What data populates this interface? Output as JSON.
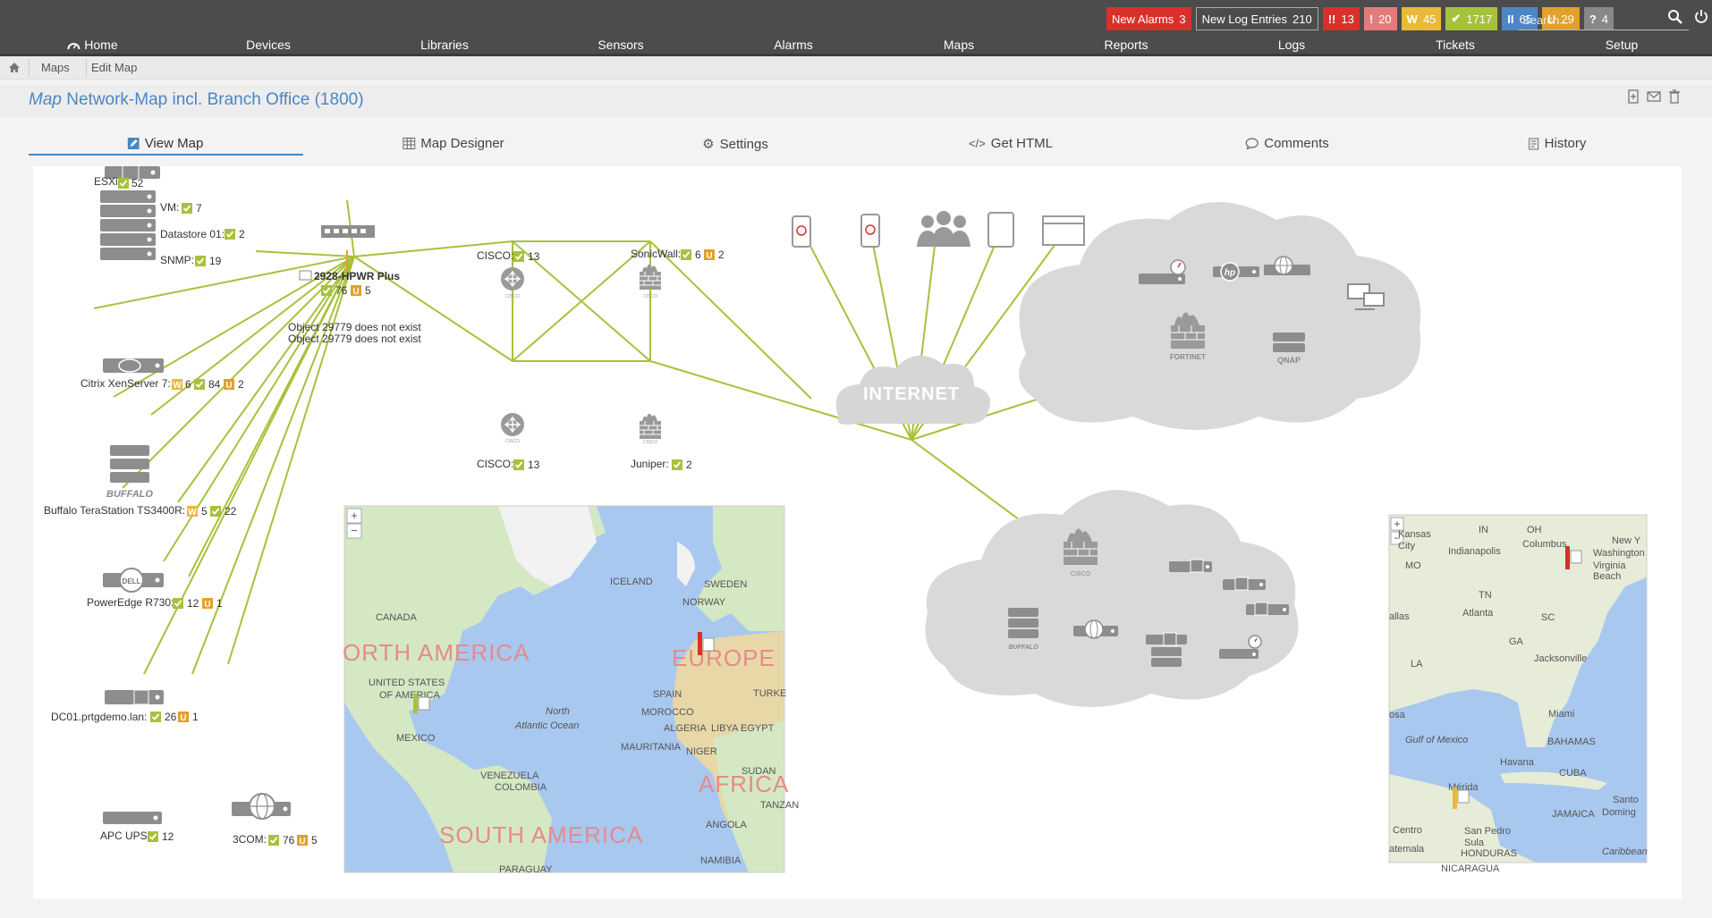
{
  "topbar": {
    "new_alarms": {
      "label": "New Alarms",
      "count": "3"
    },
    "new_log": {
      "label": "New Log Entries",
      "count": "210"
    },
    "status": [
      {
        "icon": "!!",
        "count": "13",
        "color": "#d9302a"
      },
      {
        "icon": "!",
        "count": "20",
        "color": "#e47b7b"
      },
      {
        "icon": "W",
        "count": "45",
        "color": "#e9b93a"
      },
      {
        "icon": "✔",
        "count": "1717",
        "color": "#a6c23c"
      },
      {
        "icon": "II",
        "count": "65",
        "color": "#4d86c6"
      },
      {
        "icon": "U",
        "count": "29",
        "color": "#e1a12a"
      },
      {
        "icon": "?",
        "count": "4",
        "color": "#888888"
      }
    ],
    "search_placeholder": "Search..."
  },
  "nav": [
    "Home",
    "Devices",
    "Libraries",
    "Sensors",
    "Alarms",
    "Maps",
    "Reports",
    "Logs",
    "Tickets",
    "Setup"
  ],
  "breadcrumb": [
    "Maps",
    "Edit Map"
  ],
  "page": {
    "title_prefix": "Map",
    "title": "Network-Map incl. Branch Office (1800)"
  },
  "tabs": [
    "View Map",
    "Map Designer",
    "Settings",
    "Get HTML",
    "Comments",
    "History"
  ],
  "map": {
    "devices": {
      "esxi": {
        "label": "ESXi:",
        "ok": "52"
      },
      "vm": {
        "label": "VM:",
        "ok": "7"
      },
      "datastore": {
        "label": "Datastore 01:",
        "ok": "2"
      },
      "snmp": {
        "label": "SNMP:",
        "ok": "19"
      },
      "hpwr": {
        "label": "2928-HPWR Plus",
        "ok": "76",
        "unusual": "5"
      },
      "missing1": "Object 29779 does not exist",
      "missing2": "Object 29779 does not exist",
      "citrix": {
        "label": "Citrix XenServer 7:",
        "warn": "6",
        "ok": "84",
        "unusual": "2"
      },
      "buffalo": {
        "label": "Buffalo TeraStation TS3400R:",
        "warn": "5",
        "ok": "22"
      },
      "dell": {
        "label": "PowerEdge R730:",
        "ok": "12",
        "unusual": "1"
      },
      "dc01": {
        "label": "DC01.prtgdemo.lan:",
        "ok": "26",
        "unusual": "1"
      },
      "apc": {
        "label": "APC UPS:",
        "ok": "12"
      },
      "com3": {
        "label": "3COM:",
        "ok": "76",
        "unusual": "5"
      },
      "cisco1": {
        "label": "CISCO:",
        "ok": "13"
      },
      "sonicwall": {
        "label": "SonicWall:",
        "ok": "6",
        "unusual": "2"
      },
      "cisco2": {
        "label": "CISCO:",
        "ok": "13"
      },
      "juniper": {
        "label": "Juniper:",
        "ok": "2"
      },
      "internet": "INTERNET",
      "buffalo_logo": "BUFFALO",
      "dell_logo": "DELL",
      "fortinet_logo": "FORTINET",
      "qnap_logo": "QNAP",
      "buffalo_logo2": "BUFFALO",
      "cisco_logo": "CISCO",
      "cisco_logo2": "CISCO",
      "cisco_logo3": "CISCO",
      "cisco_logo4": "CISCO"
    },
    "world_map": {
      "labels": [
        "CANADA",
        "ICELAND",
        "SWEDEN",
        "NORWAY",
        "UNITED STATES",
        "OF AMERICA",
        "SPAIN",
        "TURKE",
        "MOROCCO",
        "ALGERIA",
        "LIBYA",
        "EGYPT",
        "MEXICO",
        "MAURITANIA",
        "NIGER",
        "North",
        "Atlantic Ocean",
        "VENEZUELA",
        "COLOMBIA",
        "SUDAN",
        "TANZAN",
        "ANGOLA",
        "NAMIBIA",
        "PARAGUAY"
      ],
      "regions": [
        "ORTH AMERICA",
        "EUROPE",
        "AFRICA",
        "SOUTH AMERICA"
      ]
    },
    "us_map": {
      "labels": [
        "Kansas",
        "City",
        "IN",
        "OH",
        "MO",
        "Indianapolis",
        "Columbus",
        "New Y",
        "Washington",
        "Virginia",
        "Beach",
        "allas",
        "TN",
        "Atlanta",
        "GA",
        "SC",
        "LA",
        "Jacksonville",
        "Miami",
        "osa",
        "Gulf of Mexico",
        "BAHAMAS",
        "Havana",
        "CUBA",
        "Mérida",
        "Santo",
        "Doming",
        "JAMAICA",
        "Centro",
        "San Pedro",
        "Sula",
        "atemala",
        "HONDURAS",
        "NICARAGUA",
        "Caribbean"
      ]
    }
  }
}
